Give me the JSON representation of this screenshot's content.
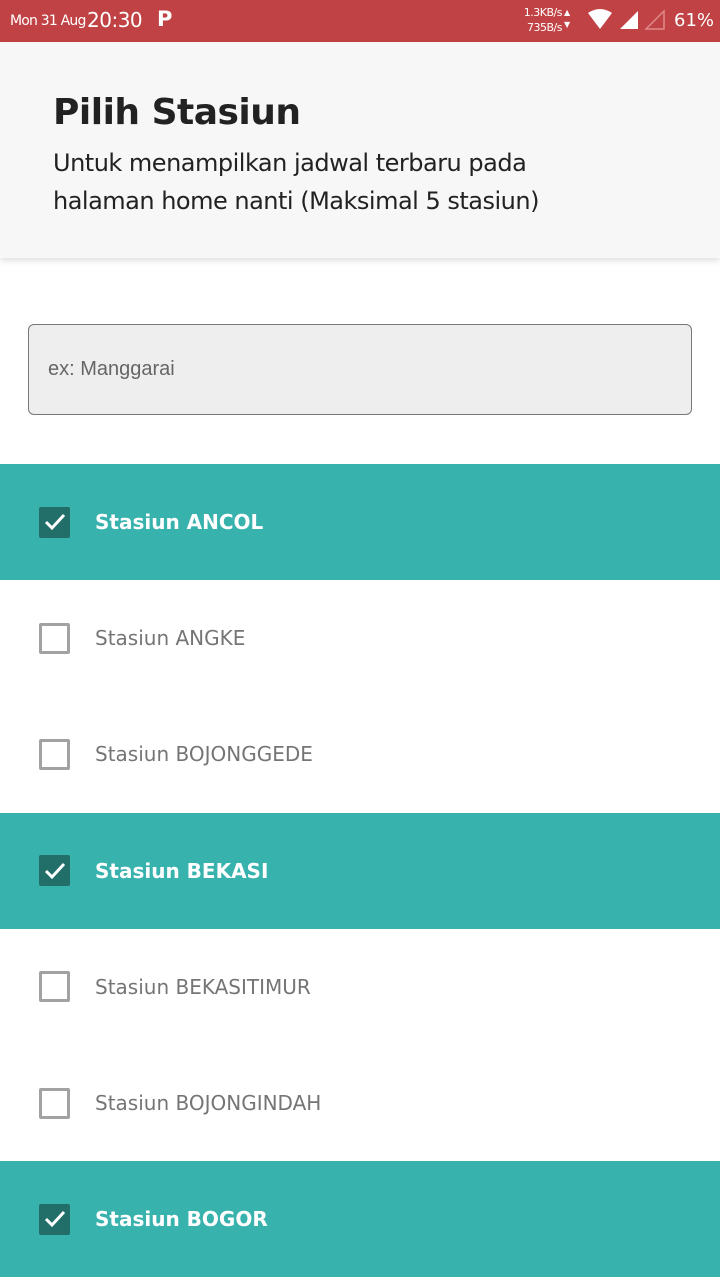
{
  "status_bar": {
    "date": "Mon 31 Aug",
    "time": "20:30",
    "app_icon": "parking-p-icon",
    "net_up": "1.3KB/s",
    "net_down": "735B/s",
    "battery": "61%",
    "colors": {
      "bar": "#c04244"
    }
  },
  "header": {
    "title": "Pilih Stasiun",
    "subtitle": "Untuk menampilkan jadwal terbaru pada halaman home nanti (Maksimal 5 stasiun)"
  },
  "search": {
    "placeholder": "ex: Manggarai",
    "value": ""
  },
  "stations": [
    {
      "label": "Stasiun ANCOL",
      "checked": true
    },
    {
      "label": "Stasiun ANGKE",
      "checked": false
    },
    {
      "label": "Stasiun BOJONGGEDE",
      "checked": false
    },
    {
      "label": "Stasiun BEKASI",
      "checked": true
    },
    {
      "label": "Stasiun BEKASITIMUR",
      "checked": false
    },
    {
      "label": "Stasiun BOJONGINDAH",
      "checked": false
    },
    {
      "label": "Stasiun BOGOR",
      "checked": true
    }
  ],
  "colors": {
    "selected_row": "#38b2ad",
    "checkbox_checked": "#226e69"
  }
}
